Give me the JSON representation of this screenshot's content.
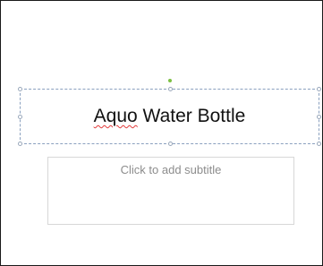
{
  "slide": {
    "title": {
      "misspelled_word": "Aquo",
      "rest": " Water Bottle"
    },
    "subtitle_placeholder": "Click to add subtitle"
  }
}
